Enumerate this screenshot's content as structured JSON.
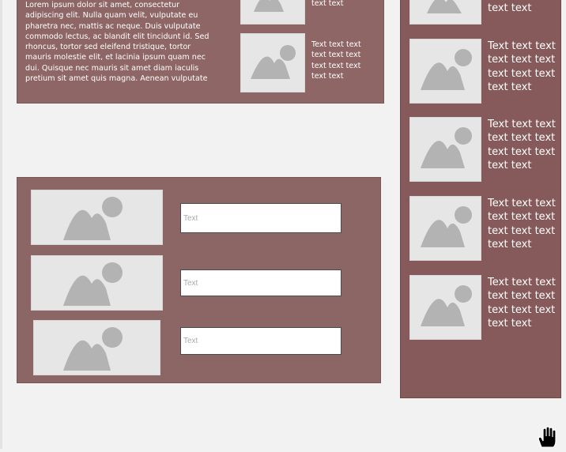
{
  "top_panel": {
    "lorem": "Lorem ipsum dolor sit amet, consectetur adipiscing elit. Nulla quam velit, vulputate eu pharetra nec, mattis ac neque. Duis vulputate commodo lectus, ac blandit elit tincidunt id. Sed rhoncus, tortor sed eleifend tristique, tortor mauris molestie elit, et lacinia ipsum quam nec dui. Quisque nec mauris sit amet diam iaculis pretium sit amet quis magna. Aenean vulputate",
    "cards": [
      {
        "text": "text text"
      },
      {
        "text": "Text text text text text text text text text text text"
      }
    ]
  },
  "right_panel": {
    "cards": [
      {
        "text": "text text"
      },
      {
        "text": "Text text text text text text text text text text text"
      },
      {
        "text": "Text text text text text text text text text text text"
      },
      {
        "text": "Text text text text text text text text text text text"
      },
      {
        "text": "Text text text text text text text text text text text"
      }
    ]
  },
  "form_panel": {
    "rows": [
      {
        "placeholder": "Text"
      },
      {
        "placeholder": "Text"
      },
      {
        "placeholder": "Text"
      }
    ]
  },
  "icons": {
    "image_placeholder": "image-placeholder-icon",
    "cursor": "hand-cursor-icon"
  },
  "colors": {
    "panel": "#8c6565",
    "sidebar": "#865a5a",
    "placeholder_bg": "#e6e6e6",
    "placeholder_glyph": "#b3b3b3",
    "background": "#f2f2f2"
  }
}
